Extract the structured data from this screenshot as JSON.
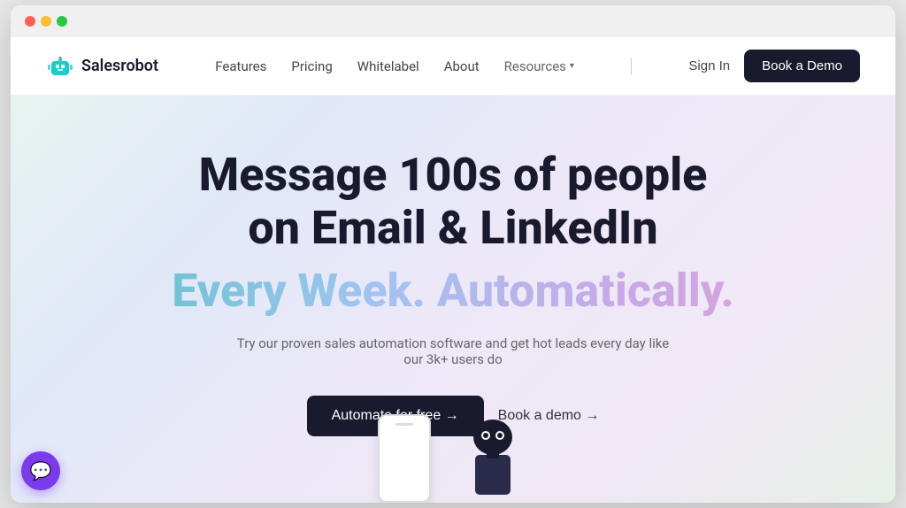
{
  "browser": {
    "traffic_lights": [
      "red",
      "yellow",
      "green"
    ]
  },
  "navbar": {
    "logo_text": "Salesrobot",
    "nav_items": [
      {
        "label": "Features",
        "id": "features"
      },
      {
        "label": "Pricing",
        "id": "pricing"
      },
      {
        "label": "Whitelabel",
        "id": "whitelabel"
      },
      {
        "label": "About",
        "id": "about"
      },
      {
        "label": "Resources",
        "id": "resources",
        "has_dropdown": true
      }
    ],
    "sign_in_label": "Sign In",
    "book_demo_label": "Book a Demo"
  },
  "hero": {
    "title_line1": "Message 100s of people",
    "title_line2": "on Email & LinkedIn",
    "title_gradient": "Every Week. Automatically.",
    "subtitle": "Try our proven sales automation software and get hot leads every day like our 3k+ users do",
    "cta_primary": "Automate for free →",
    "cta_secondary": "Book a demo →"
  },
  "chat_widget": {
    "icon": "💬"
  }
}
